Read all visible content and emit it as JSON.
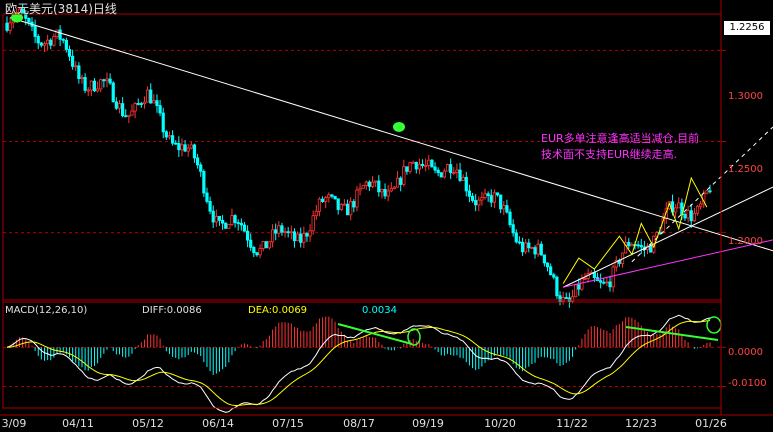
{
  "title": "欧元美元(3814)日线",
  "note_lines": [
    "EUR多单注意逢高适当减仓,目前",
    "技术面不支持EUR继续走高."
  ],
  "price_axis": {
    "last_price": "1.2256",
    "ticks": [
      {
        "value": 1.3,
        "label": "1.3000"
      },
      {
        "value": 1.25,
        "label": "1.2500"
      },
      {
        "value": 1.2,
        "label": "1.2000"
      }
    ],
    "range": [
      1.163,
      1.32
    ]
  },
  "macd_axis": {
    "ticks": [
      {
        "value": 0.0,
        "label": "0.0000"
      },
      {
        "value": -0.01,
        "label": "-0.0100"
      }
    ],
    "range": [
      -0.0155,
      0.0075
    ]
  },
  "x_labels": [
    "3/09",
    "04/11",
    "05/12",
    "06/14",
    "07/15",
    "08/17",
    "09/19",
    "10/20",
    "11/22",
    "12/23",
    "01/26"
  ],
  "macd_header": {
    "name": "MACD(12,26,10)",
    "diff_label": "DIFF:0.0086",
    "dea_label": "DEA:0.0069",
    "hist_label": "0.0034"
  },
  "colors": {
    "background": "#000000",
    "up_candle": "#ff3333",
    "down_candle": "#00ffff",
    "grid": "#aa0000",
    "trendline": "#ffffff",
    "channel_lower": "#ff33ff",
    "wave_lines": "#ffff00",
    "dashed_projection": "#ffffff",
    "highlight": "#33ff33",
    "diff_line": "#ffffff",
    "dea_line": "#ffff00",
    "note_text": "#ff33ff"
  },
  "chart_data": {
    "type": "candlestick",
    "price_path": [
      {
        "x": "3/09",
        "y": 1.315
      },
      {
        "x": "04/11",
        "y": 1.288
      },
      {
        "x": "05/12",
        "y": 1.274
      },
      {
        "x": "06/14",
        "y": 1.203
      },
      {
        "x": "07/15",
        "y": 1.203
      },
      {
        "x": "08/17",
        "y": 1.212
      },
      {
        "x": "09/19",
        "y": 1.249
      },
      {
        "x": "10/20",
        "y": 1.202
      },
      {
        "x": "11/22",
        "y": 1.173
      },
      {
        "x": "12/23",
        "y": 1.185
      },
      {
        "x": "01/26",
        "y": 1.228
      }
    ],
    "last_value": 1.2256,
    "macd": {
      "diff": 0.0086,
      "dea": 0.0069,
      "histogram": 0.0034
    }
  }
}
